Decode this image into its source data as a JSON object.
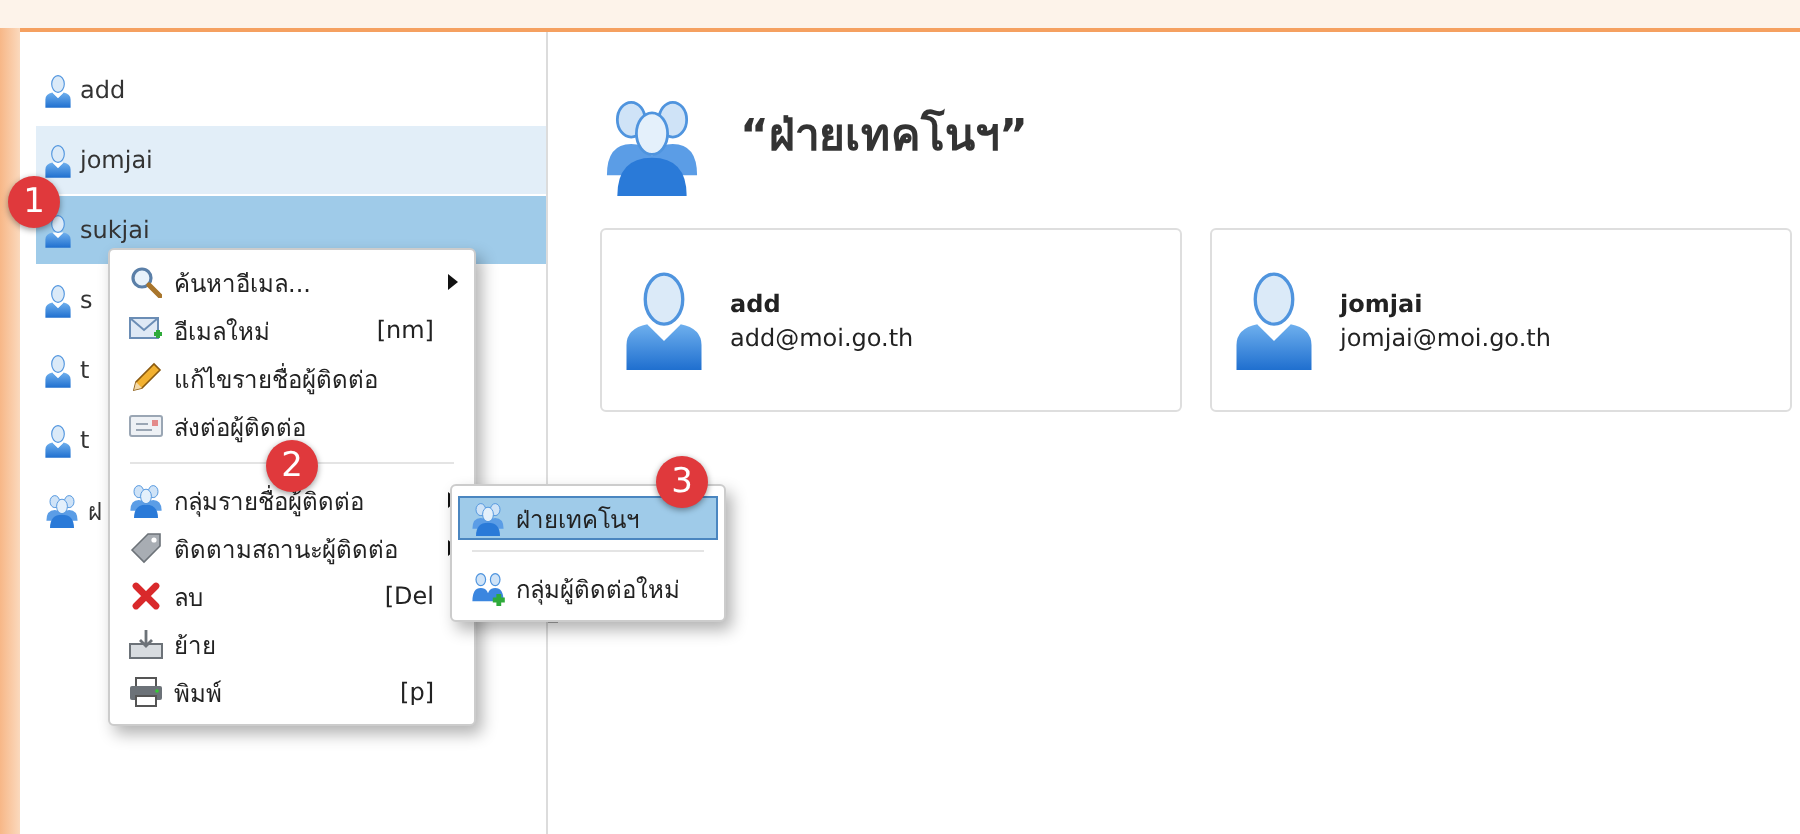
{
  "sidebar": {
    "items": [
      {
        "name": "add",
        "kind": "contact",
        "selected": false,
        "hovered": false
      },
      {
        "name": "jomjai",
        "kind": "contact",
        "selected": false,
        "hovered": true
      },
      {
        "name": "sukjai",
        "kind": "contact",
        "selected": true,
        "hovered": false
      },
      {
        "name": "s",
        "kind": "contact",
        "selected": false,
        "hovered": false
      },
      {
        "name": "t",
        "kind": "contact",
        "selected": false,
        "hovered": false
      },
      {
        "name": "t",
        "kind": "contact",
        "selected": false,
        "hovered": false
      },
      {
        "name": "ฝ",
        "kind": "group",
        "selected": false,
        "hovered": false
      }
    ]
  },
  "context_menu": {
    "items": [
      {
        "kind": "item",
        "label": "ค้นหาอีเมล...",
        "submenu": true
      },
      {
        "kind": "item",
        "label": "อีเมลใหม่",
        "shortcut": "[nm]",
        "submenu": false
      },
      {
        "kind": "item",
        "label": "แก้ไขรายชื่อผู้ติดต่อ",
        "submenu": false
      },
      {
        "kind": "item",
        "label": "ส่งต่อผู้ติดต่อ",
        "submenu": false
      },
      {
        "kind": "separator"
      },
      {
        "kind": "item",
        "label": "กลุ่มรายชื่อผู้ติดต่อ",
        "submenu": true
      },
      {
        "kind": "item",
        "label": "ติดตามสถานะผู้ติดต่อ",
        "submenu": true
      },
      {
        "kind": "item",
        "label": "ลบ",
        "shortcut": "[Del",
        "submenu": false
      },
      {
        "kind": "item",
        "label": "ย้าย",
        "submenu": false
      },
      {
        "kind": "item",
        "label": "พิมพ์",
        "shortcut": "[p]",
        "submenu": false
      }
    ]
  },
  "submenu": {
    "items": [
      {
        "kind": "item",
        "label": "ฝ่ายเทคโนฯ",
        "selected": true
      },
      {
        "kind": "separator"
      },
      {
        "kind": "item",
        "label": "กลุ่มผู้ติดต่อใหม่",
        "selected": false
      }
    ]
  },
  "group": {
    "title": "“ฝ่ายเทคโนฯ”",
    "members": [
      {
        "name": "add",
        "email": "add@moi.go.th"
      },
      {
        "name": "jomjai",
        "email": "jomjai@moi.go.th"
      }
    ]
  },
  "annotations": [
    {
      "label": "1"
    },
    {
      "label": "2"
    },
    {
      "label": "3"
    }
  ]
}
